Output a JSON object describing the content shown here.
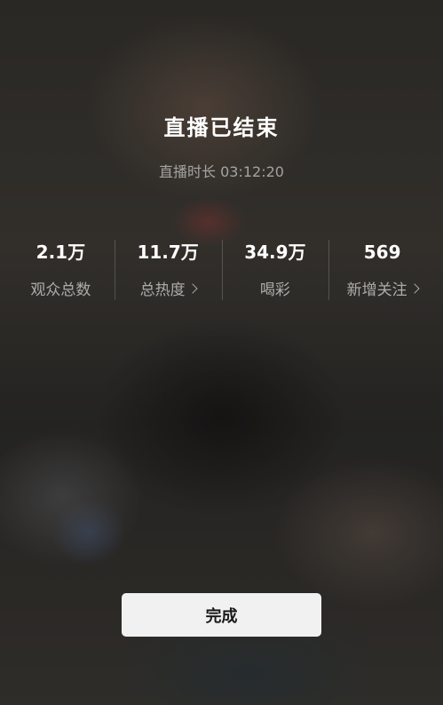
{
  "screen": {
    "title": "直播已结束",
    "duration_label": "直播时长 03:12:20"
  },
  "stats": [
    {
      "value": "2.1万",
      "label": "观众总数",
      "has_arrow": false
    },
    {
      "value": "11.7万",
      "label": "总热度",
      "has_arrow": true
    },
    {
      "value": "34.9万",
      "label": "喝彩",
      "has_arrow": false
    },
    {
      "value": "569",
      "label": "新增关注",
      "has_arrow": true
    }
  ],
  "done_button": {
    "label": "完成"
  },
  "colors": {
    "text_primary": "#ffffff",
    "button_bg": "#f1f1f1",
    "button_text": "#1a1a1a"
  },
  "icons": {
    "arrow": "chevron-right-icon"
  }
}
